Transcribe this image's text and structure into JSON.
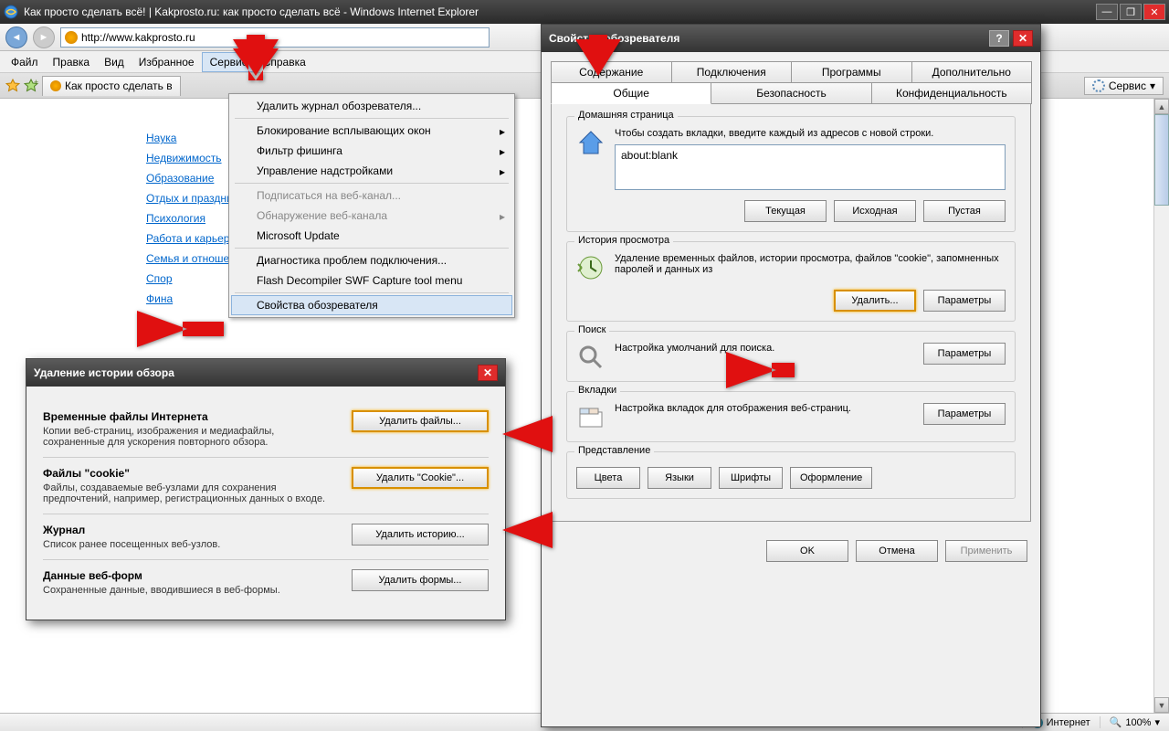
{
  "window": {
    "title": "Как просто сделать всё! | Kakprosto.ru: как просто сделать всё - Windows Internet Explorer",
    "address": "http://www.kakprosto.ru"
  },
  "menubar": [
    "Файл",
    "Правка",
    "Вид",
    "Избранное",
    "Сервис",
    "Справка"
  ],
  "tab": "Как просто сделать в",
  "tools_btn": "Сервис",
  "sidebar": [
    "Наука",
    "Недвижимость",
    "Образование",
    "Отдых и праздники",
    "Психология",
    "Работа и карьера",
    "Семья и отношения",
    "Спор",
    "Фина"
  ],
  "dropdown": {
    "items": [
      {
        "label": "Удалить журнал обозревателя...",
        "type": "item"
      },
      {
        "type": "sep"
      },
      {
        "label": "Блокирование всплывающих окон",
        "type": "sub"
      },
      {
        "label": "Фильтр фишинга",
        "type": "sub"
      },
      {
        "label": "Управление надстройками",
        "type": "sub"
      },
      {
        "type": "sep"
      },
      {
        "label": "Подписаться на веб-канал...",
        "type": "disabled"
      },
      {
        "label": "Обнаружение веб-канала",
        "type": "disabled-sub"
      },
      {
        "label": "Microsoft Update",
        "type": "item"
      },
      {
        "type": "sep"
      },
      {
        "label": "Диагностика проблем подключения...",
        "type": "item"
      },
      {
        "label": "Flash Decompiler SWF Capture tool menu",
        "type": "item"
      },
      {
        "type": "sep"
      },
      {
        "label": "Свойства обозревателя",
        "type": "item",
        "hl": true
      }
    ]
  },
  "opts": {
    "title": "Свойства обозревателя",
    "tabs_row1": [
      "Содержание",
      "Подключения",
      "Программы",
      "Дополнительно"
    ],
    "tabs_row2": [
      "Общие",
      "Безопасность",
      "Конфиденциальность"
    ],
    "active_tab": "Общие",
    "home": {
      "label": "Домашняя страница",
      "text": "Чтобы создать вкладки, введите каждый из адресов с новой строки.",
      "value": "about:blank",
      "btns": [
        "Текущая",
        "Исходная",
        "Пустая"
      ]
    },
    "history": {
      "label": "История просмотра",
      "text": "Удаление временных файлов, истории просмотра, файлов \"cookie\", запомненных паролей и данных из",
      "btns": [
        "Удалить...",
        "Параметры"
      ]
    },
    "search": {
      "label": "Поиск",
      "text": "Настройка умолчаний для поиска.",
      "btn": "Параметры"
    },
    "vtabs": {
      "label": "Вкладки",
      "text": "Настройка вкладок для отображения веб-страниц.",
      "btn": "Параметры"
    },
    "rep": {
      "label": "Представление",
      "btns": [
        "Цвета",
        "Языки",
        "Шрифты",
        "Оформление"
      ]
    },
    "footer": [
      "OK",
      "Отмена",
      "Применить"
    ]
  },
  "del": {
    "title": "Удаление истории обзора",
    "sections": [
      {
        "h": "Временные файлы Интернета",
        "t": "Копии веб-страниц, изображения и медиафайлы, сохраненные для ускорения повторного обзора.",
        "b": "Удалить файлы..."
      },
      {
        "h": "Файлы \"cookie\"",
        "t": "Файлы, создаваемые веб-узлами для сохранения предпочтений, например, регистрационных данных о входе.",
        "b": "Удалить \"Cookie\"..."
      },
      {
        "h": "Журнал",
        "t": "Список ранее посещенных веб-узлов.",
        "b": "Удалить историю..."
      },
      {
        "h": "Данные веб-форм",
        "t": "Сохраненные данные, вводившиеся в веб-формы.",
        "b": "Удалить формы..."
      }
    ]
  },
  "status": {
    "zone": "Интернет",
    "zoom": "100%"
  }
}
